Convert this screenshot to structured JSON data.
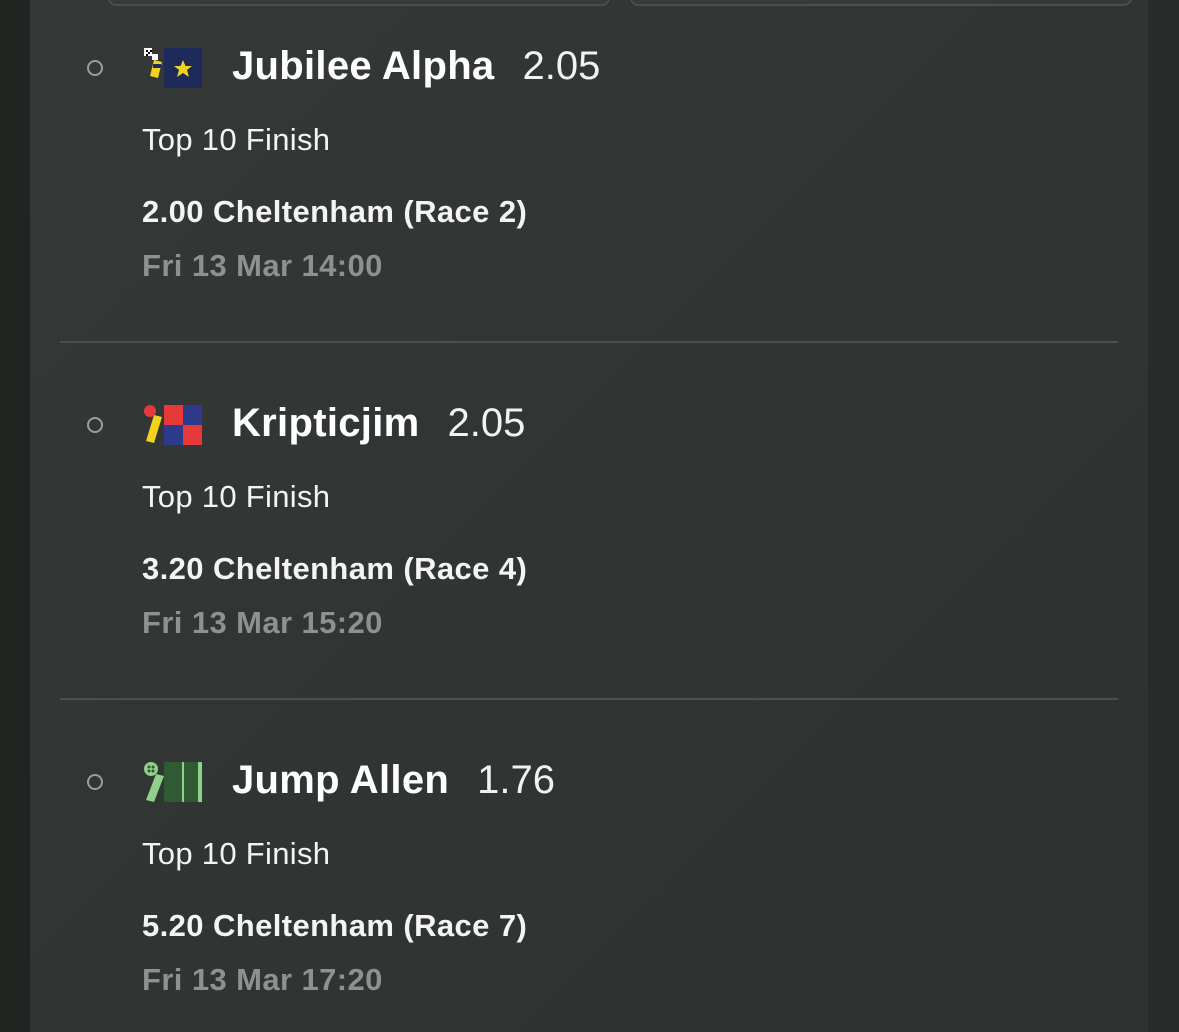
{
  "selections": [
    {
      "runner": "Jubilee Alpha",
      "odds": "2.05",
      "market": "Top 10 Finish",
      "race": "2.00 Cheltenham (Race 2)",
      "time": "Fri 13 Mar 14:00",
      "silks_icon": "jockey-silks-navy-star-icon"
    },
    {
      "runner": "Kripticjim",
      "odds": "2.05",
      "market": "Top 10 Finish",
      "race": "3.20 Cheltenham (Race 4)",
      "time": "Fri 13 Mar 15:20",
      "silks_icon": "jockey-silks-red-blue-check-icon"
    },
    {
      "runner": "Jump Allen",
      "odds": "1.76",
      "market": "Top 10 Finish",
      "race": "5.20 Cheltenham (Race 7)",
      "time": "Fri 13 Mar 17:20",
      "silks_icon": "jockey-silks-green-icon"
    }
  ],
  "colors": {
    "background": "#303432",
    "text_primary": "#ffffff",
    "text_muted": "#8d918f",
    "divider": "#4b4f4d"
  }
}
